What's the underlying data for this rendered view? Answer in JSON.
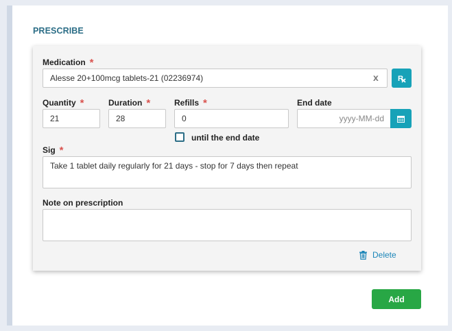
{
  "section": {
    "title": "PRESCRIBE"
  },
  "medication": {
    "label": "Medication",
    "required_mark": "*",
    "value": "Alesse 20+100mcg tablets-21 (02236974)",
    "clear_label": "x"
  },
  "quantity": {
    "label": "Quantity",
    "required_mark": "*",
    "value": "21"
  },
  "duration": {
    "label": "Duration",
    "required_mark": "*",
    "value": "28"
  },
  "refills": {
    "label": "Refills",
    "required_mark": "*",
    "value": "0",
    "until_end_label": "until the end date",
    "until_end_checked": false
  },
  "end_date": {
    "label": "End date",
    "placeholder": "yyyy-MM-dd"
  },
  "sig": {
    "label": "Sig",
    "required_mark": "*",
    "value": "Take 1 tablet daily regularly for 21 days - stop for 7 days then repeat"
  },
  "note": {
    "label": "Note on prescription",
    "value": ""
  },
  "delete_label": "Delete",
  "add_label": "Add",
  "colors": {
    "accent_teal": "#17a2b8",
    "add_green": "#28a745",
    "required_red": "#d9534f",
    "title_teal": "#2b6d86"
  }
}
